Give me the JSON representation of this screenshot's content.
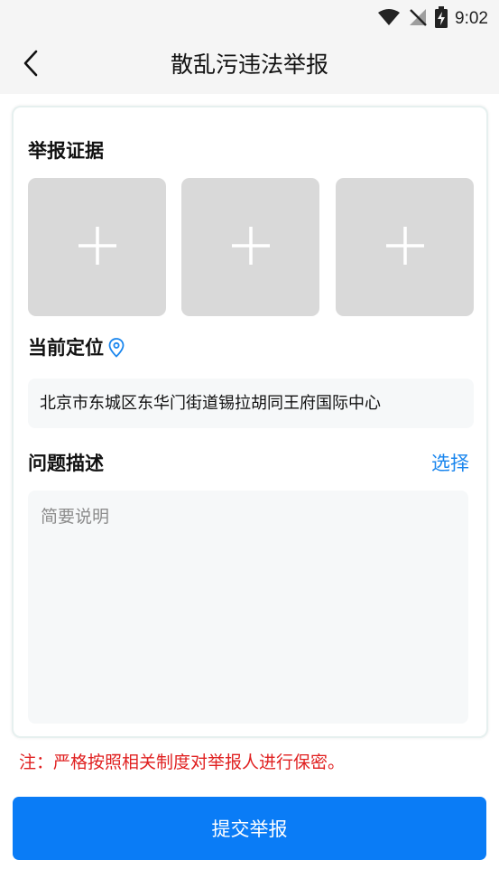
{
  "status_bar": {
    "time": "9:02",
    "icons": [
      "wifi-icon",
      "no-signal-icon",
      "battery-charging-icon"
    ]
  },
  "header": {
    "title": "散乱污违法举报",
    "back_icon": "chevron-left-icon"
  },
  "evidence": {
    "label": "举报证据",
    "slots": [
      "plus-icon",
      "plus-icon",
      "plus-icon"
    ]
  },
  "location": {
    "label": "当前定位",
    "icon": "location-pin-icon",
    "address": "北京市东城区东华门街道锡拉胡同王府国际中心"
  },
  "description": {
    "label": "问题描述",
    "select_label": "选择",
    "placeholder": "简要说明",
    "value": ""
  },
  "notice": "注：严格按照相关制度对举报人进行保密。",
  "submit_label": "提交举报",
  "colors": {
    "accent": "#0a7cf6",
    "link": "#1a86ee",
    "warning": "#e02020",
    "slot_bg": "#d9d9d9",
    "field_bg": "#f6f8f9",
    "header_bg": "#f5f5f5"
  }
}
